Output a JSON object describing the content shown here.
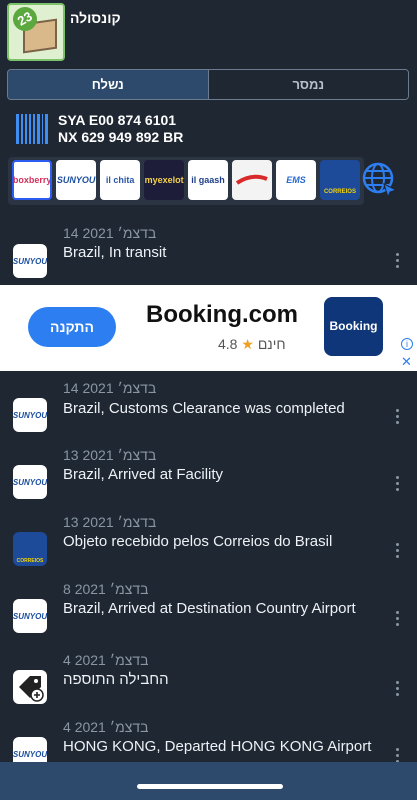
{
  "header": {
    "title": "קונסולה",
    "badge_count": "23"
  },
  "tabs": [
    {
      "label": "נשלח",
      "active": true
    },
    {
      "label": "נמסר",
      "active": false
    }
  ],
  "tracking": {
    "line1": "SYA E00 874 6101",
    "line2": "NX 629 949 892 BR"
  },
  "carriers": [
    {
      "name": "boxberry"
    },
    {
      "name": "SUNYOU"
    },
    {
      "name": "il chita"
    },
    {
      "name": "myexelot"
    },
    {
      "name": "il gaash"
    },
    {
      "name": ""
    },
    {
      "name": "EMS"
    },
    {
      "name": "CORREIOS"
    }
  ],
  "ad": {
    "cta": "התקנה",
    "title": "Booking.com",
    "rating": "4.8",
    "price": "חינם",
    "logo_text": "Booking"
  },
  "events": [
    {
      "date": "14 בדצמ׳ 2021",
      "text": "Brazil,  In transit",
      "icon": "SUNYOU"
    },
    {
      "date": "14 בדצמ׳ 2021",
      "text": "Brazil,  Customs Clearance was completed",
      "icon": "SUNYOU"
    },
    {
      "date": "13 בדצמ׳ 2021",
      "text": "Brazil,  Arrived at Facility",
      "icon": "SUNYOU"
    },
    {
      "date": "13 בדצמ׳ 2021",
      "text": "Objeto recebido pelos Correios do Brasil",
      "icon": "CORREIOS"
    },
    {
      "date": "8 בדצמ׳ 2021",
      "text": "Brazil,  Arrived at Destination Country Airport",
      "icon": "SUNYOU"
    },
    {
      "date": "4 בדצמ׳ 2021",
      "text": "החבילה התוספה",
      "icon": "add-tag"
    },
    {
      "date": "4 בדצמ׳ 2021",
      "text": "HONG KONG,  Departed HONG KONG Airport",
      "icon": "SUNYOU"
    }
  ]
}
